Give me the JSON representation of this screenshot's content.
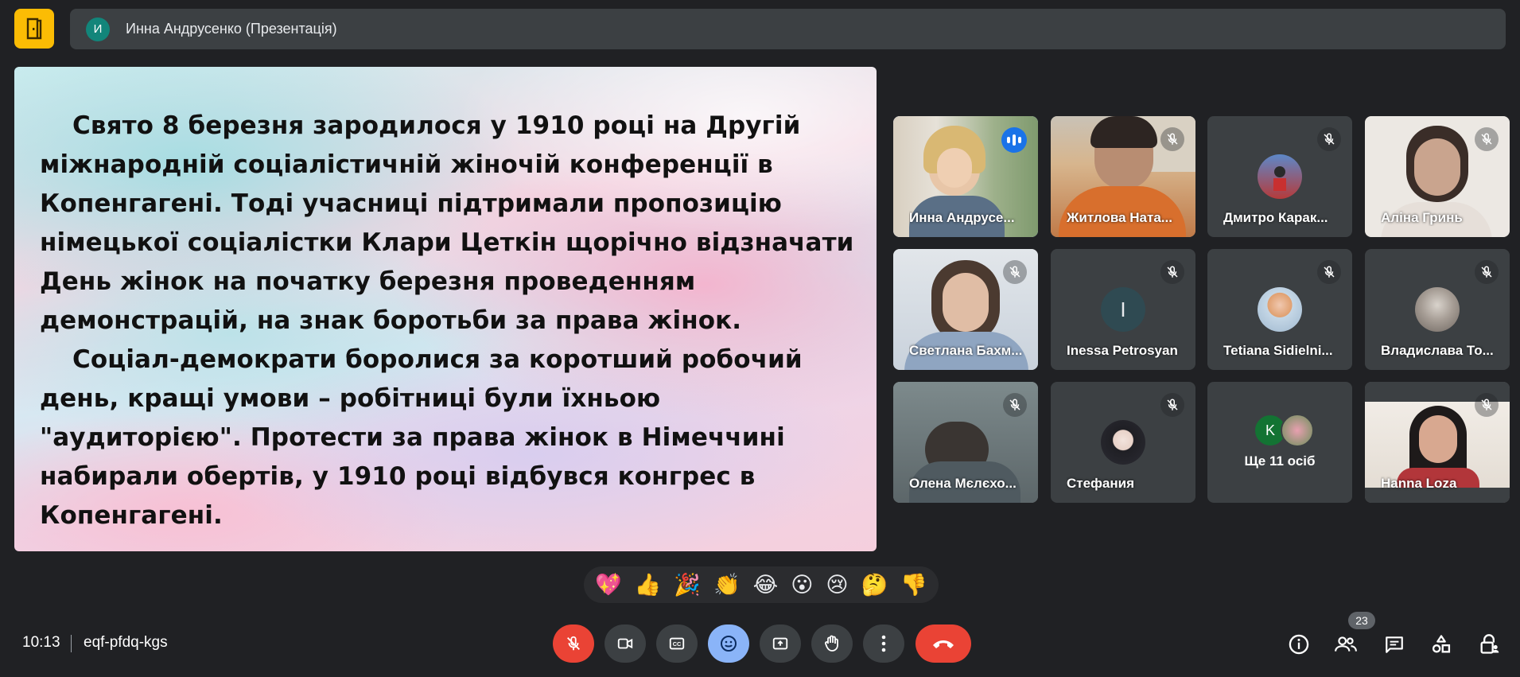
{
  "header": {
    "presenter_initial": "И",
    "title": "Инна Андрусенко (Презентація)"
  },
  "slide": {
    "paragraph1": "Свято 8 березня зародилося у 1910 році на Другій міжнародній соціалістичній жіночій конференції в Копенгагені. Тоді учасниці підтримали пропозицію німецької соціалістки Клари Цеткін щорічно відзначати День жінок на початку березня проведенням демонстрацій, на знак боротьби за права жінок.",
    "paragraph2": "Соціал-демократи боролися за коротший робочий день, кращі умови – робітниці були їхньою \"аудиторією\". Протести за права жінок в Німеччині набирали обертів, у 1910 році відбувся конгрес в Копенгагені."
  },
  "participants": [
    {
      "name": "Инна Андрусе...",
      "state": "speaking"
    },
    {
      "name": "Житлова Ната...",
      "state": "muted"
    },
    {
      "name": "Дмитро Карак...",
      "state": "muted"
    },
    {
      "name": "Аліна Гринь",
      "state": "muted"
    },
    {
      "name": "Светлана Бахм...",
      "state": "muted"
    },
    {
      "name": "Inessa Petrosyan",
      "state": "muted",
      "initial": "I"
    },
    {
      "name": "Tetiana Sidielni...",
      "state": "muted"
    },
    {
      "name": "Владислава То...",
      "state": "muted"
    },
    {
      "name": "Олена Мєлєхо...",
      "state": "muted"
    },
    {
      "name": "Стефания",
      "state": "muted"
    },
    {
      "name": "Ще 11 осіб",
      "state": "more",
      "initial": "K"
    },
    {
      "name": "Hanna Loza",
      "state": "muted"
    }
  ],
  "reactions": [
    "💖",
    "👍",
    "🎉",
    "👏",
    "😂",
    "😮",
    "😢",
    "🤔",
    "👎"
  ],
  "footer": {
    "time": "10:13",
    "meeting_code": "eqf-pfdq-kgs",
    "participant_count": "23"
  },
  "colors": {
    "background": "#202124",
    "surface": "#3c4043",
    "accent_yellow": "#fbbc04",
    "accent_blue": "#8ab4f8",
    "danger_red": "#ea4335"
  },
  "icons": {
    "logo": "door-icon",
    "mic": "mic-off-icon",
    "camera": "videocam-icon",
    "captions": "closed-caption-icon",
    "emoji": "emoji-icon",
    "present": "present-screen-icon",
    "hand": "raise-hand-icon",
    "more": "more-vert-icon",
    "leave": "call-end-icon",
    "info": "info-icon",
    "people": "people-icon",
    "chat": "chat-icon",
    "activities": "activities-icon",
    "host_controls": "lock-person-icon"
  }
}
